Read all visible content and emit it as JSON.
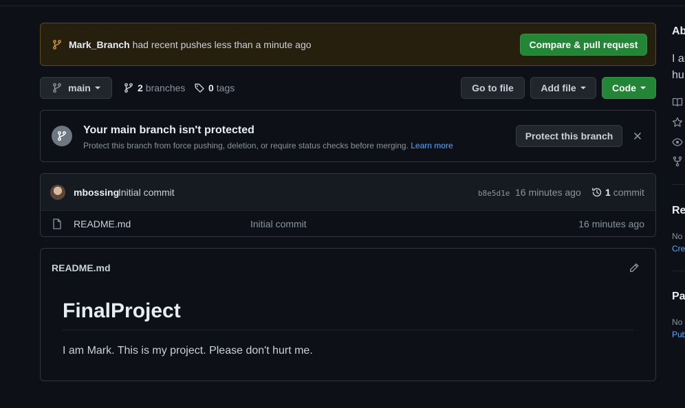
{
  "push_banner": {
    "branch": "Mark_Branch",
    "message": "had recent pushes less than a minute ago",
    "button": "Compare & pull request"
  },
  "branch_bar": {
    "current_branch": "main",
    "branches_count": "2",
    "branches_label": "branches",
    "tags_count": "0",
    "tags_label": "tags",
    "go_to_file": "Go to file",
    "add_file": "Add file",
    "code": "Code"
  },
  "protect_banner": {
    "title": "Your main branch isn't protected",
    "description": "Protect this branch from force pushing, deletion, or require status checks before merging.",
    "learn_more": "Learn more",
    "button": "Protect this branch"
  },
  "latest_commit": {
    "author": "mbossing",
    "message": "Initial commit",
    "sha": "b8e5d1e",
    "time": "16 minutes ago",
    "commit_count": "1",
    "commit_label": "commit"
  },
  "files": [
    {
      "name": "README.md",
      "message": "Initial commit",
      "time": "16 minutes ago"
    }
  ],
  "readme": {
    "filename": "README.md",
    "heading": "FinalProject",
    "body": "I am Mark. This is my project. Please don't hurt me."
  },
  "sidebar": {
    "about_heading": "Ab",
    "about_line1": "I ar",
    "about_line2": "hu",
    "releases_heading": "Re",
    "releases_none": "No",
    "releases_link": "Cre",
    "packages_heading": "Pac",
    "packages_none": "No",
    "packages_link": "Pub"
  },
  "colors": {
    "background": "#0d1117",
    "accent_green": "#238636",
    "link_blue": "#58a6ff",
    "banner_bg": "#271f0e"
  }
}
